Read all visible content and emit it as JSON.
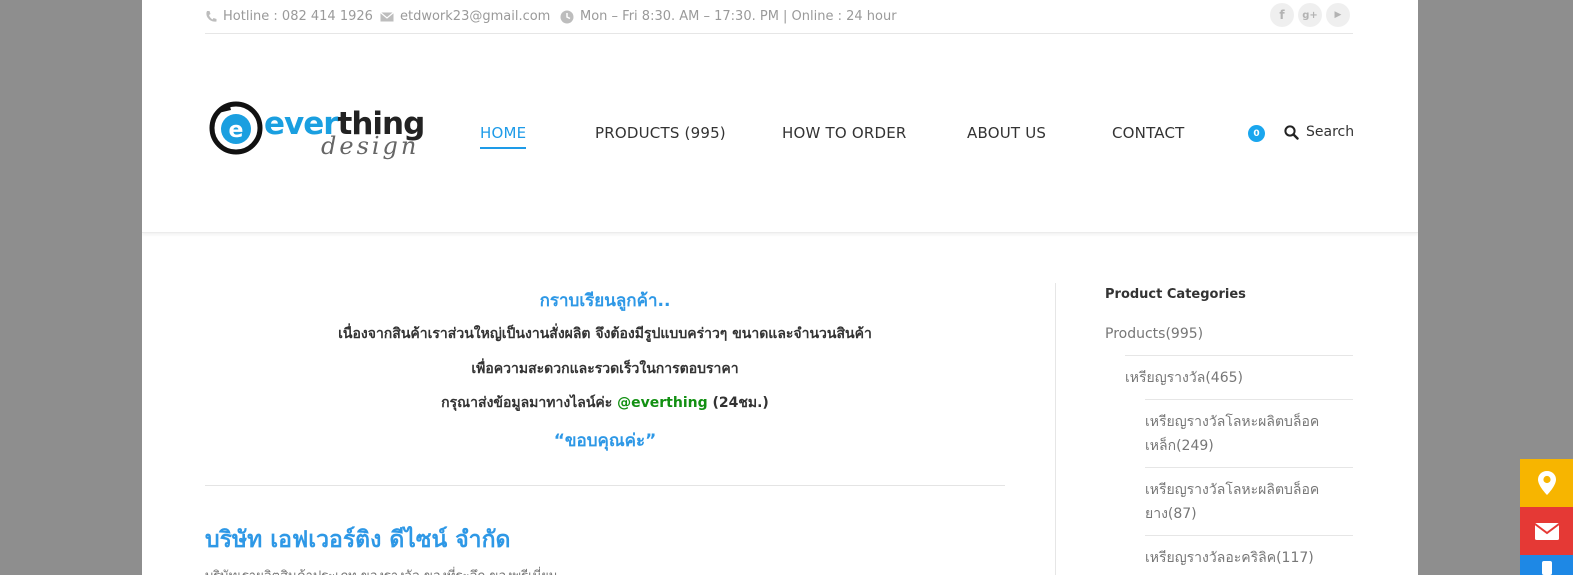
{
  "topbar": {
    "hotline": "Hotline : 082 414 1926",
    "email": "etdwork23@gmail.com",
    "hours": "Mon – Fri 8:30. AM – 17:30. PM | Online : 24 hour",
    "social": [
      {
        "name": "facebook-icon",
        "glyph": "f"
      },
      {
        "name": "google-plus-icon",
        "glyph": "g+"
      },
      {
        "name": "youtube-icon",
        "glyph": "▶"
      }
    ]
  },
  "logo": {
    "main_blue": "ever",
    "main_dark": "thing",
    "sub": "design"
  },
  "nav": {
    "items": [
      {
        "label": "HOME",
        "active": true
      },
      {
        "label": "PRODUCTS (995)"
      },
      {
        "label": "HOW TO ORDER"
      },
      {
        "label": "ABOUT US"
      },
      {
        "label": "CONTACT"
      }
    ],
    "cart_count": "0",
    "search_label": "Search"
  },
  "notice": {
    "greeting": "กราบเรียนลูกค้า..",
    "line1": "เนื่องจากสินค้าเราส่วนใหญ่เป็นงานสั่งผลิต จึงต้องมีรูปแบบคร่าวๆ ขนาดและจำนวนสินค้า",
    "line2": "เพื่อความสะดวกและรวดเร็วในการตอบราคา",
    "line3_prefix": "กรุณาส่งข้อมูลมาทางไลน์ค่ะ ",
    "line3_id": "@everthing",
    "line3_suffix": " (24ชม.)",
    "thanks": "“ขอบคุณค่ะ”"
  },
  "company": {
    "title": "บริษัท เอฟเวอร์ติง ดีไซน์ จำกัด",
    "desc": "บริษัทเราผลิตสินค้าประเภท ของรางวัล ของที่ระลึก ของพรีเมี่ยม"
  },
  "sidebar": {
    "title": "Product Categories",
    "categories": [
      {
        "label": "Products",
        "count": "(995)"
      },
      {
        "label": "เหรียญรางวัล",
        "count": "(465)"
      },
      {
        "label": "เหรียญรางวัลโลหะผลิตบล็อค",
        "label2": "เหล็ก",
        "count": "(249)"
      },
      {
        "label": "เหรียญรางวัลโลหะผลิตบล็อค",
        "label2": "ยาง",
        "count": "(87)"
      },
      {
        "label": "เหรียญรางวัลอะคริลิค",
        "count": "(117)"
      }
    ]
  },
  "floating": [
    {
      "name": "location-icon",
      "color": "#f7b500"
    },
    {
      "name": "mail-icon",
      "color": "#e53935"
    },
    {
      "name": "phone-icon",
      "color": "#1e88e5"
    }
  ]
}
